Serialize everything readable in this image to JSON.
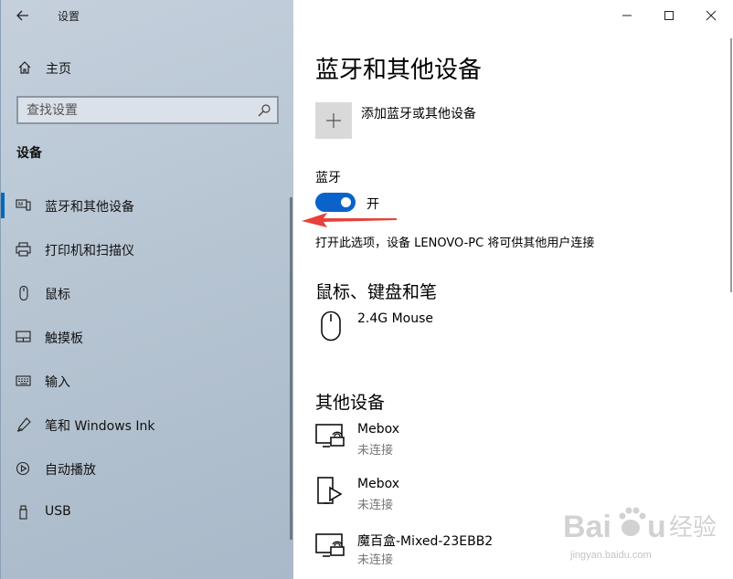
{
  "window": {
    "title": "设置",
    "controls": {
      "minimize": "minimize",
      "maximize": "maximize",
      "close": "close"
    }
  },
  "sidebar": {
    "home_label": "主页",
    "search_placeholder": "查找设置",
    "section_title": "设备",
    "items": [
      {
        "label": "蓝牙和其他设备",
        "icon": "bluetooth-devices-icon",
        "active": true
      },
      {
        "label": "打印机和扫描仪",
        "icon": "printer-icon",
        "active": false
      },
      {
        "label": "鼠标",
        "icon": "mouse-icon",
        "active": false
      },
      {
        "label": "触摸板",
        "icon": "touchpad-icon",
        "active": false
      },
      {
        "label": "输入",
        "icon": "keyboard-icon",
        "active": false
      },
      {
        "label": "笔和 Windows Ink",
        "icon": "pen-icon",
        "active": false
      },
      {
        "label": "自动播放",
        "icon": "autoplay-icon",
        "active": false
      },
      {
        "label": "USB",
        "icon": "usb-icon",
        "active": false
      }
    ]
  },
  "main": {
    "page_title": "蓝牙和其他设备",
    "add_device_label": "添加蓝牙或其他设备",
    "bluetooth_label": "蓝牙",
    "bluetooth_state": "开",
    "bluetooth_on": true,
    "bluetooth_description": "打开此选项，设备 LENOVO-PC 将可供其他用户连接",
    "mouse_section_title": "鼠标、键盘和笔",
    "mouse_devices": [
      {
        "name": "2.4G Mouse",
        "status": "",
        "icon": "mouse-device-icon"
      }
    ],
    "other_section_title": "其他设备",
    "other_devices": [
      {
        "name": "Mebox",
        "status": "未连接",
        "icon": "wireless-display-icon"
      },
      {
        "name": "Mebox",
        "status": "未连接",
        "icon": "media-player-icon"
      },
      {
        "name": "魔百盒-Mixed-23EBB2",
        "status": "未连接",
        "icon": "wireless-display-icon"
      }
    ]
  },
  "watermark": {
    "brand_latin_1": "Bai",
    "brand_latin_2": "u",
    "brand_cn": "经验",
    "url": "jingyan.baidu.com"
  },
  "colors": {
    "accent": "#0a63c9",
    "sidebar_bg": "#b7c5d3",
    "annotation_arrow": "#e8413c"
  }
}
